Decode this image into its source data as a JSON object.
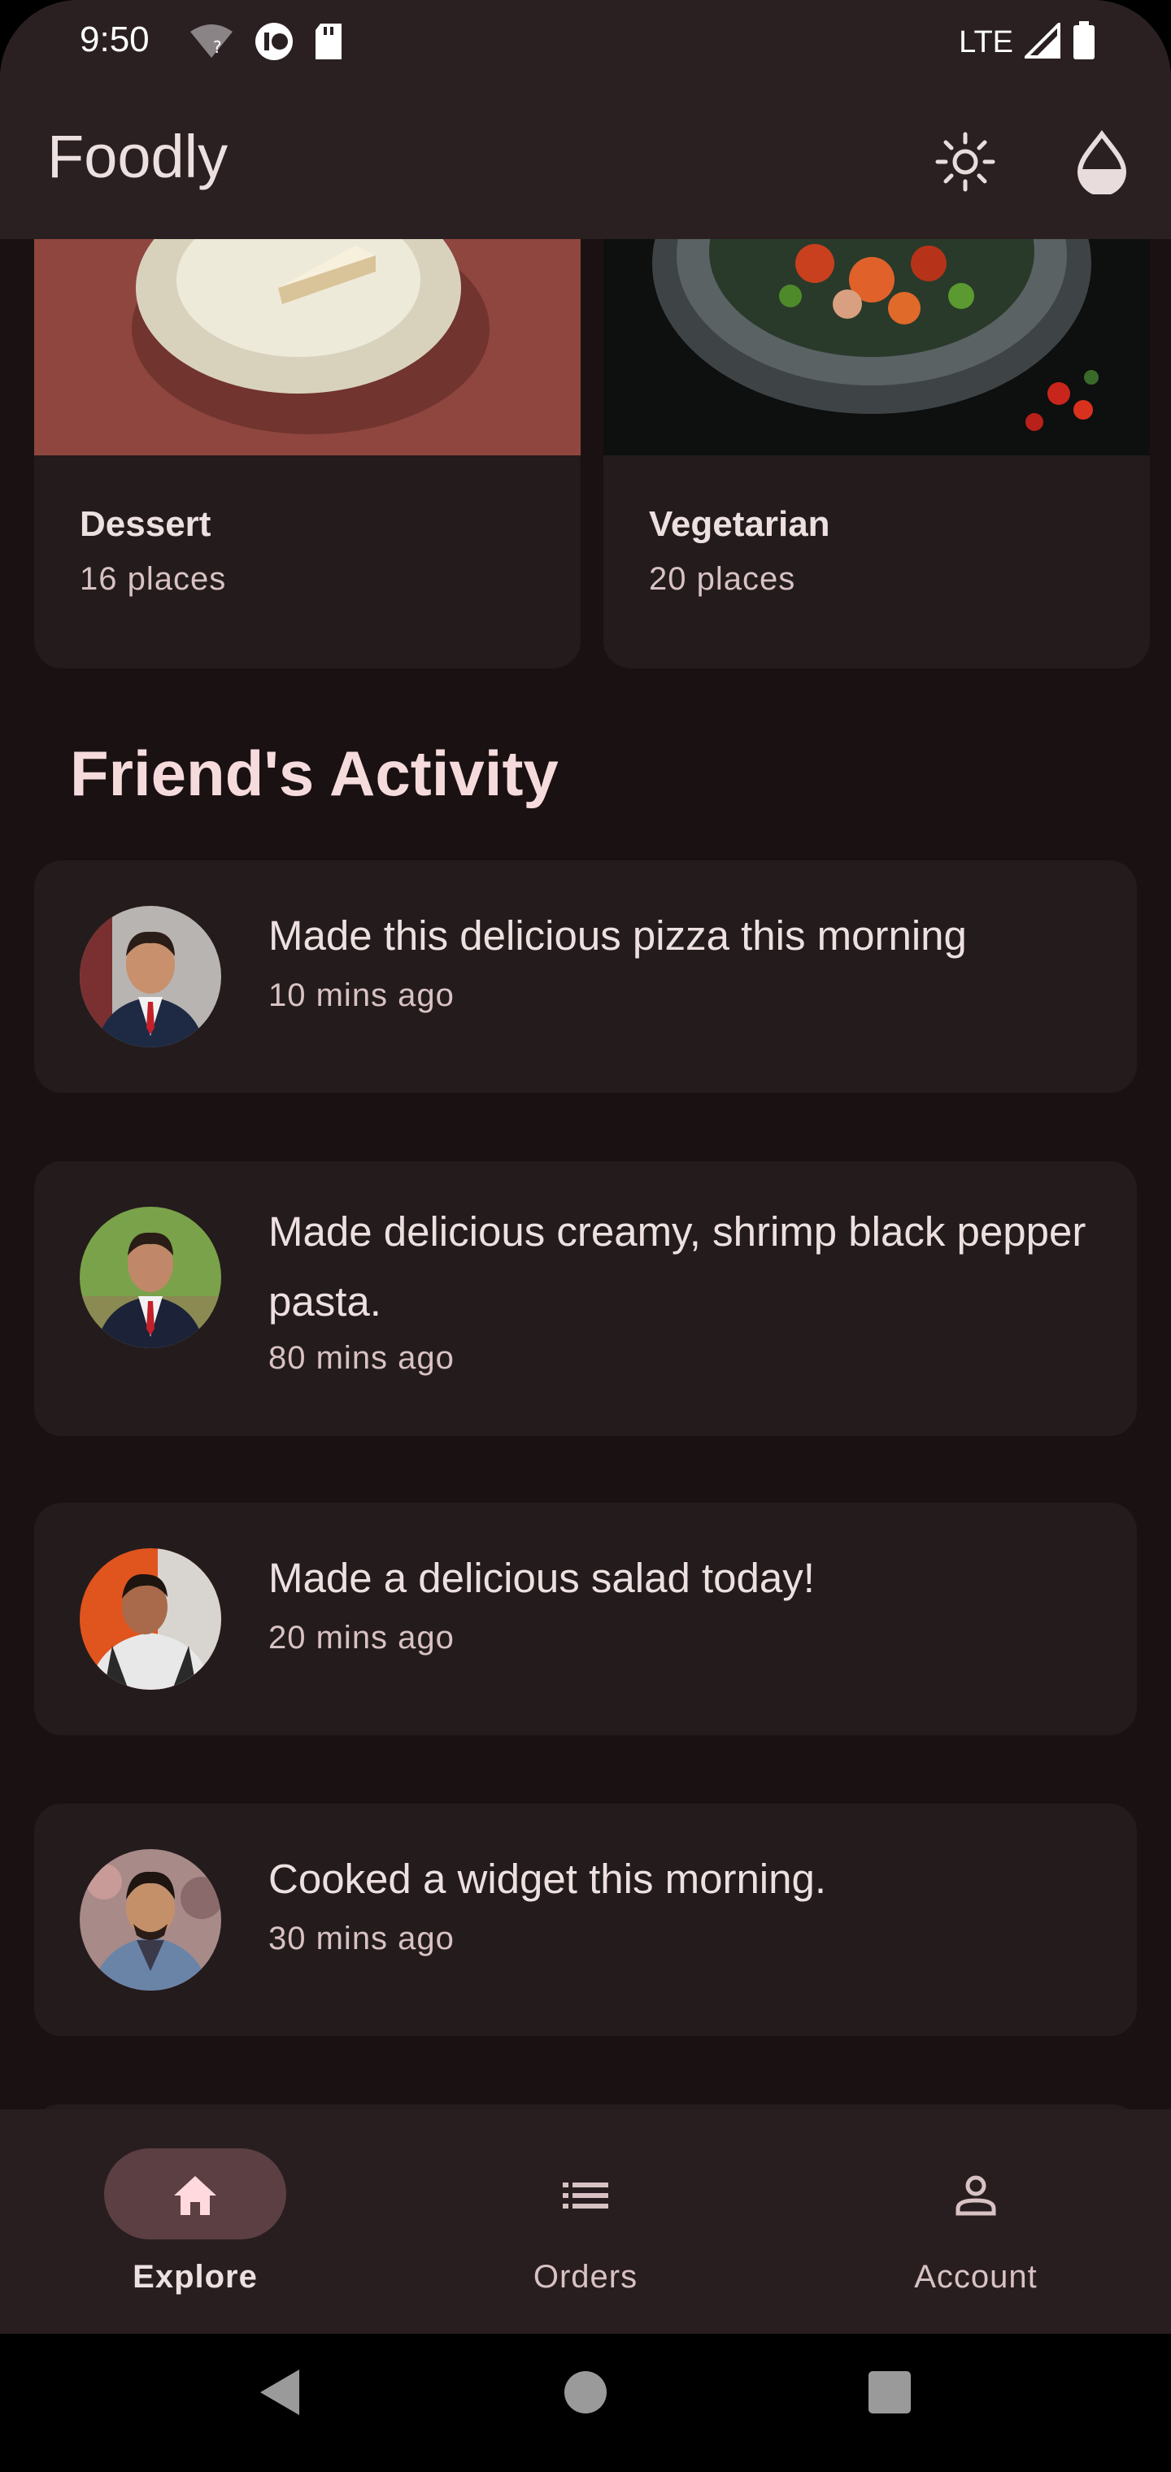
{
  "status_bar": {
    "time": "9:50",
    "network": "LTE"
  },
  "app_bar": {
    "title": "Foodly"
  },
  "categories": [
    {
      "title": "Dessert",
      "subtitle": "16 places"
    },
    {
      "title": "Vegetarian",
      "subtitle": "20 places"
    }
  ],
  "activity": {
    "section_title": "Friend's Activity",
    "items": [
      {
        "text": "Made this delicious pizza this morning",
        "time": "10 mins ago"
      },
      {
        "text": "Made delicious creamy, shrimp black pepper pasta.",
        "time": "80 mins ago"
      },
      {
        "text": "Made a delicious salad today!",
        "time": "20 mins ago"
      },
      {
        "text": "Cooked a widget this morning.",
        "time": "30 mins ago"
      }
    ]
  },
  "bottom_nav": [
    {
      "label": "Explore",
      "icon": "home-icon",
      "selected": true
    },
    {
      "label": "Orders",
      "icon": "list-icon",
      "selected": false
    },
    {
      "label": "Account",
      "icon": "person-icon",
      "selected": false
    }
  ],
  "colors": {
    "background": "#1a1112",
    "surface": "#241b1c",
    "app_bar": "#2a2022",
    "nav_pill": "#5c3f42",
    "accent_pink": "#ffb2bb"
  }
}
